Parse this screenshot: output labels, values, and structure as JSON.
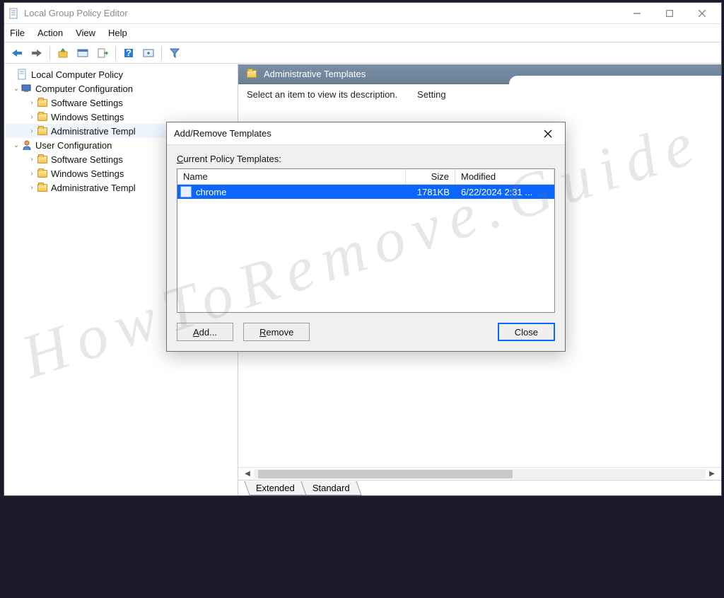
{
  "window": {
    "title": "Local Group Policy Editor"
  },
  "menubar": {
    "file": "File",
    "action": "Action",
    "view": "View",
    "help": "Help"
  },
  "tree": {
    "root": "Local Computer Policy",
    "comp": "Computer Configuration",
    "comp_sw": "Software Settings",
    "comp_win": "Windows Settings",
    "comp_admin": "Administrative Templ",
    "user": "User Configuration",
    "user_sw": "Software Settings",
    "user_win": "Windows Settings",
    "user_admin": "Administrative Templ"
  },
  "pane": {
    "header": "Administrative Templates",
    "desc": "Select an item to view its description.",
    "col_setting": "Setting",
    "tab_ext": "Extended",
    "tab_std": "Standard"
  },
  "dialog": {
    "title": "Add/Remove Templates",
    "label_prefix": "C",
    "label_rest": "urrent Policy Templates:",
    "col_name": "Name",
    "col_size": "Size",
    "col_mod": "Modified",
    "row": {
      "name": "chrome",
      "size": "1781KB",
      "modified": "6/22/2024 2:31 ..."
    },
    "btn_add_u": "A",
    "btn_add_rest": "dd...",
    "btn_rem_u": "R",
    "btn_rem_rest": "emove",
    "btn_close": "Close"
  },
  "watermark": "HowToRemove.Guide"
}
